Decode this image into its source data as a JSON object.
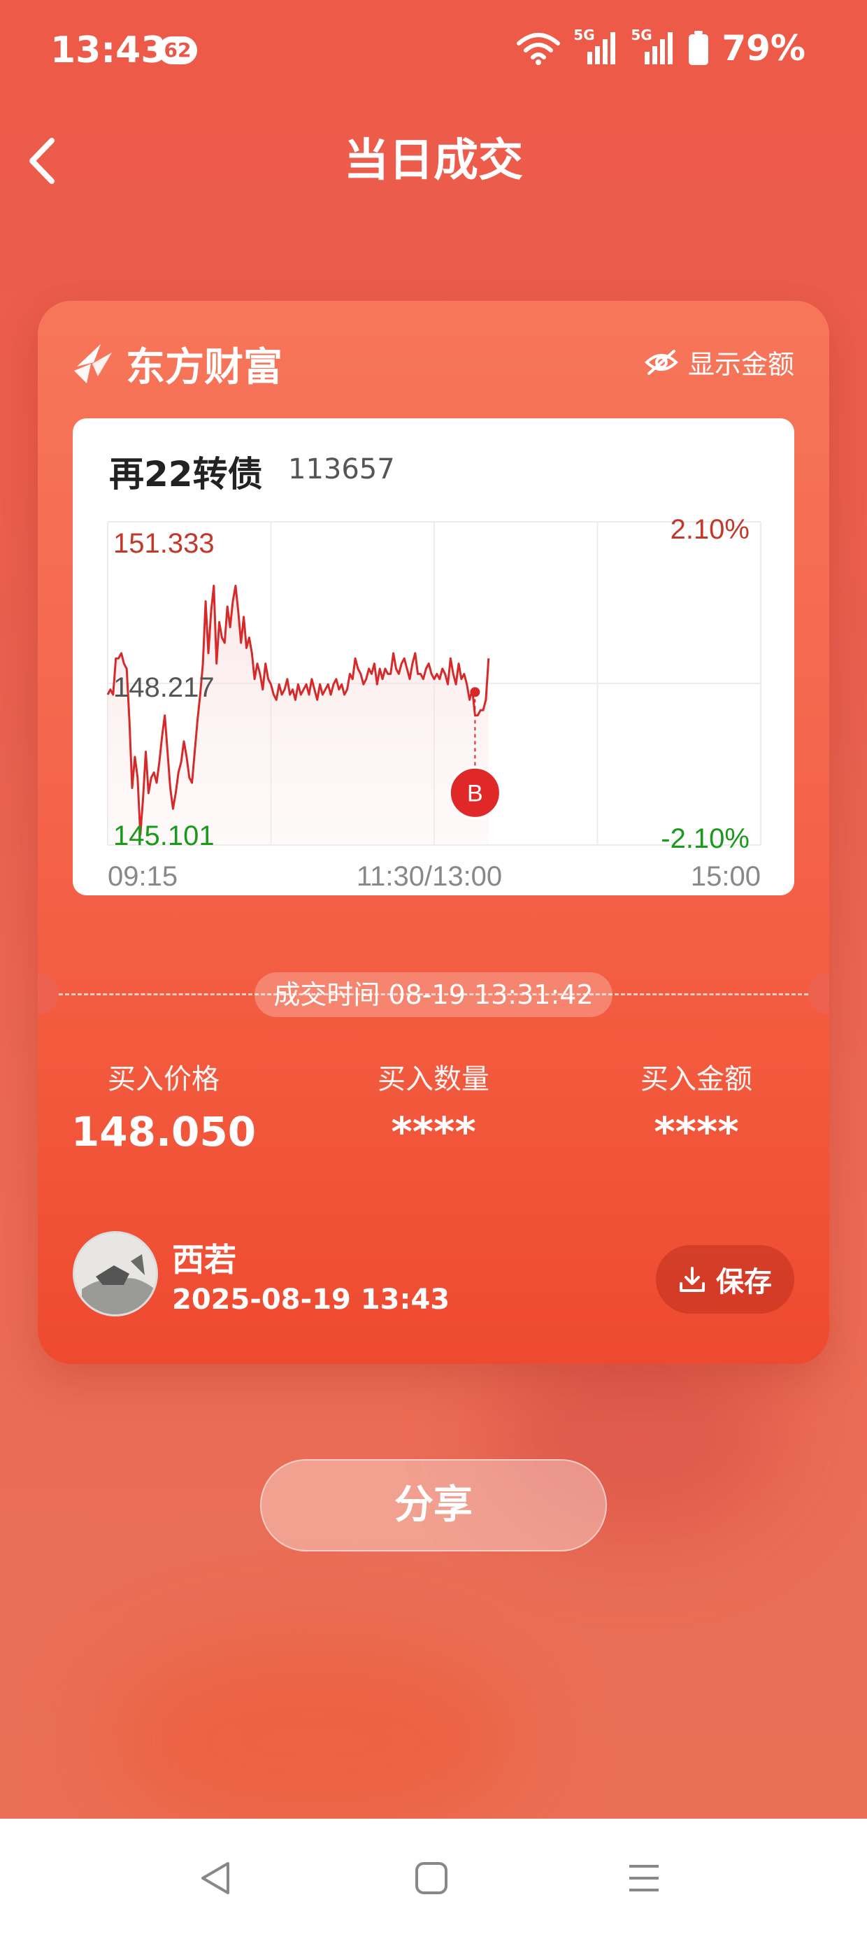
{
  "status_bar": {
    "time": "13:43",
    "notification_count": "62",
    "battery": "79%",
    "network_1": "5G",
    "network_2": "5G"
  },
  "header": {
    "title": "当日成交"
  },
  "card": {
    "brand": "东方财富",
    "show_amount_label": "显示金额",
    "stock": {
      "name": "再22转债",
      "code": "113657"
    },
    "trade_time": "成交时间 08-19 13:31:42",
    "stats": [
      {
        "label": "买入价格",
        "value": "148.050"
      },
      {
        "label": "买入数量",
        "value": "****"
      },
      {
        "label": "买入金额",
        "value": "****"
      }
    ],
    "user": {
      "name": "西若",
      "datetime": "2025-08-19 13:43"
    },
    "save_label": "保存"
  },
  "share_label": "分享",
  "colors": {
    "accent": "#f35a3e",
    "up": "#d62a2a",
    "down": "#1a9a1a"
  },
  "chart_data": {
    "type": "line",
    "y_high_label": "151.333",
    "y_mid_label": "148.217",
    "y_low_label": "145.101",
    "pct_high_label": "2.10%",
    "pct_low_label": "-2.10%",
    "x_tick_labels": [
      "09:15",
      "11:30/13:00",
      "15:00"
    ],
    "ylim": [
      145.101,
      151.333
    ],
    "series": [
      {
        "values": [
          148.0,
          148.1,
          148.0,
          148.7,
          148.7,
          148.8,
          148.6,
          148.5,
          147.5,
          146.2,
          146.8,
          146.4,
          145.3,
          146.0,
          146.9,
          146.1,
          146.4,
          146.5,
          146.3,
          146.7,
          147.2,
          147.6,
          146.9,
          146.2,
          145.8,
          146.1,
          146.5,
          146.7,
          147.1,
          146.8,
          146.4,
          146.3,
          146.9,
          147.5,
          148.0,
          148.6,
          149.8,
          148.8,
          149.6,
          150.1,
          148.6,
          149.4,
          149.1,
          149.0,
          149.7,
          149.3,
          149.8,
          150.1,
          149.6,
          149.0,
          149.5,
          148.9,
          149.1,
          148.8,
          148.3,
          148.6,
          148.4,
          148.1,
          148.6,
          148.3,
          148.2,
          148.0,
          147.9,
          148.2,
          148.0,
          148.1,
          148.3,
          148.0,
          148.1,
          147.9,
          148.2,
          148.0,
          148.1,
          148.2,
          148.0,
          148.3,
          148.1,
          147.9,
          148.2,
          148.0,
          148.1,
          148.2,
          148.0,
          148.2,
          148.3,
          148.1,
          148.2,
          148.0,
          148.1,
          148.4,
          148.3,
          148.7,
          148.5,
          148.4,
          148.2,
          148.3,
          148.5,
          148.4,
          148.6,
          148.2,
          148.5,
          148.3,
          148.5,
          148.4,
          148.4,
          148.8,
          148.5,
          148.4,
          148.6,
          148.7,
          148.5,
          148.3,
          148.6,
          148.8,
          148.4,
          148.4,
          148.3,
          148.5,
          148.6,
          148.4,
          148.3,
          148.4,
          148.3,
          148.5,
          148.4,
          148.2,
          148.7,
          148.4,
          148.2,
          148.6,
          148.3,
          148.4,
          148.2,
          147.9,
          148.1,
          147.6,
          147.6,
          147.7,
          147.7,
          147.9,
          148.7
        ],
        "buy_marker": {
          "label": "B",
          "value": 148.05
        }
      }
    ]
  }
}
